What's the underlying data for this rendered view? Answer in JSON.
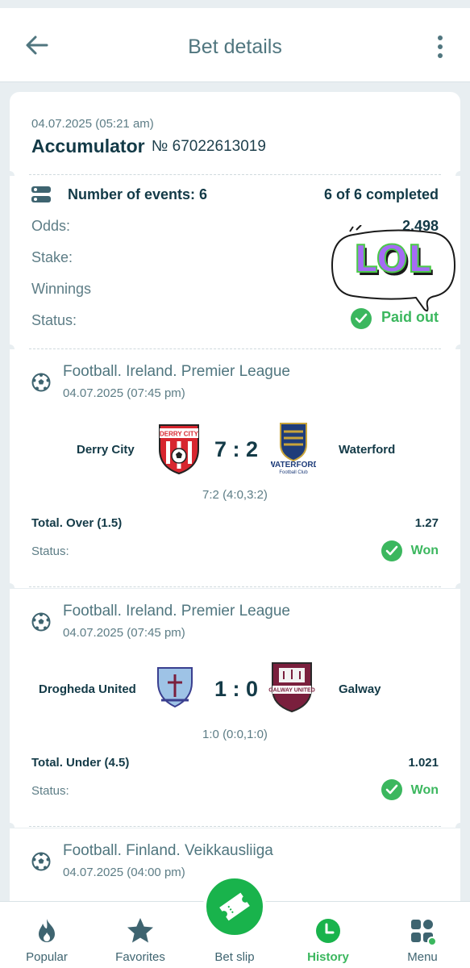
{
  "header": {
    "title": "Bet details"
  },
  "bet": {
    "date": "04.07.2025 (05:21 am)",
    "type": "Accumulator",
    "number": "№ 67022613019",
    "events_label": "Number of events: 6",
    "events_progress": "6 of 6 completed",
    "odds_label": "Odds:",
    "odds_value": "2.498",
    "stake_label": "Stake:",
    "winnings_label": "Winnings",
    "status_label": "Status:",
    "status_value": "Paid out"
  },
  "sticker": {
    "text": "LOL"
  },
  "events": [
    {
      "league": "Football. Ireland. Premier League",
      "date": "04.07.2025 (07:45 pm)",
      "home": "Derry City",
      "away": "Waterford",
      "score": "7 : 2",
      "detail": "7:2 (4:0,3:2)",
      "market": "Total. Over (1.5)",
      "odds": "1.27",
      "status_label": "Status:",
      "status": "Won",
      "home_crest_text": "DERRY CITY",
      "away_crest_text": "WATERFORD",
      "away_crest_sub": "Football Club"
    },
    {
      "league": "Football. Ireland. Premier League",
      "date": "04.07.2025 (07:45 pm)",
      "home": "Drogheda United",
      "away": "Galway",
      "score": "1 : 0",
      "detail": "1:0 (0:0,1:0)",
      "market": "Total. Under (4.5)",
      "odds": "1.021",
      "status_label": "Status:",
      "status": "Won",
      "away_crest_text": "GALWAY UNITED"
    },
    {
      "league": "Football. Finland. Veikkausliiga",
      "date": "04.07.2025 (04:00 pm)"
    }
  ],
  "nav": {
    "items": [
      {
        "label": "Popular",
        "icon": "flame-icon"
      },
      {
        "label": "Favorites",
        "icon": "star-icon"
      },
      {
        "label": "Bet slip",
        "icon": "ticket-icon"
      },
      {
        "label": "History",
        "icon": "clock-icon"
      },
      {
        "label": "Menu",
        "icon": "grid-icon"
      }
    ],
    "active": "History"
  },
  "colors": {
    "accent_green": "#3bb75e",
    "fab_green": "#19b34c",
    "text_dark": "#133a47",
    "text_muted": "#5d7d86",
    "background": "#e8eef1"
  }
}
